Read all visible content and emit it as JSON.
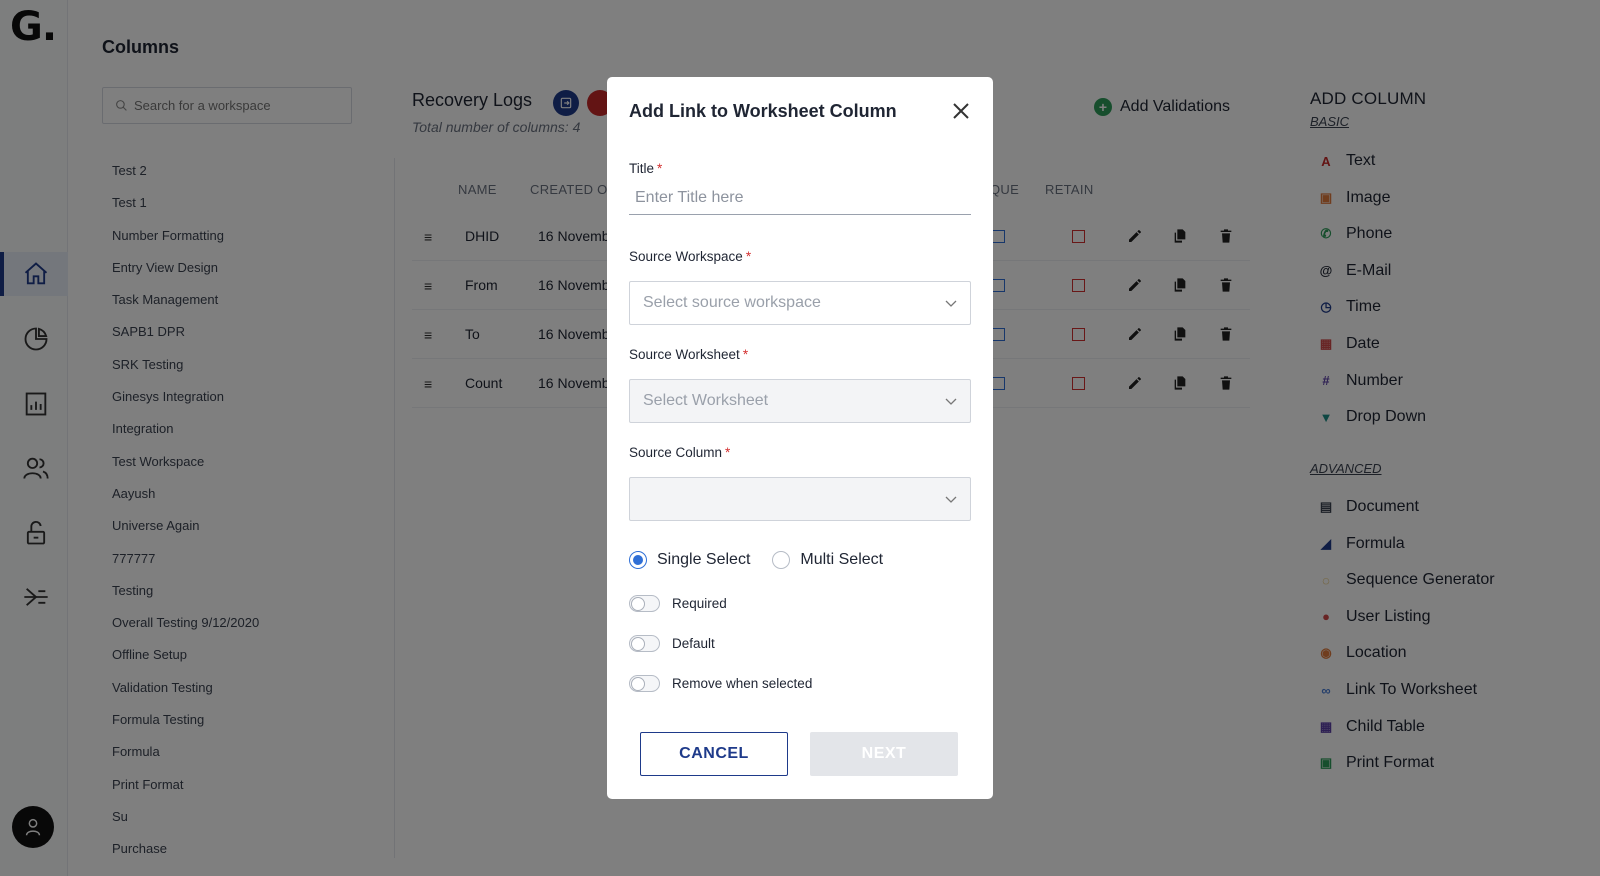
{
  "app": {
    "logo": "G."
  },
  "page": {
    "title": "Columns",
    "search_placeholder": "Search for a workspace"
  },
  "workspaces": [
    "Test 2",
    "Test 1",
    "Number Formatting",
    "Entry View Design",
    "Task Management",
    "SAPB1 DPR",
    "SRK Testing",
    "Ginesys Integration",
    "Integration",
    "Test Workspace",
    "Aayush",
    "Universe Again",
    "777777",
    "Testing",
    "Overall Testing 9/12/2020",
    "Offline Setup",
    "Validation Testing",
    "Formula Testing",
    "Formula",
    "Print Format",
    "Su",
    "Purchase"
  ],
  "table": {
    "title": "Recovery Logs",
    "subtitle": "Total number of columns: 4",
    "headers": {
      "name": "NAME",
      "created": "CREATED O",
      "unique": "QUE",
      "retain": "RETAIN"
    },
    "rows": [
      {
        "name": "DHID",
        "created": "16 Novemb"
      },
      {
        "name": "From",
        "created": "16 Novemb"
      },
      {
        "name": "To",
        "created": "16 Novemb"
      },
      {
        "name": "Count",
        "created": "16 Novemb"
      }
    ],
    "add_validations": "Add Validations"
  },
  "add_column": {
    "title": "ADD COLUMN",
    "basic_label": "BASIC",
    "advanced_label": "ADVANCED",
    "basic": [
      {
        "label": "Text",
        "icon": "text-icon",
        "color": "#c62828"
      },
      {
        "label": "Image",
        "icon": "image-icon",
        "color": "#e07a3c"
      },
      {
        "label": "Phone",
        "icon": "phone-icon",
        "color": "#2e9d5a"
      },
      {
        "label": "E-Mail",
        "icon": "email-icon",
        "color": "#1f2533"
      },
      {
        "label": "Time",
        "icon": "clock-icon",
        "color": "#1e3a8a"
      },
      {
        "label": "Date",
        "icon": "calendar-icon",
        "color": "#d04848"
      },
      {
        "label": "Number",
        "icon": "hash-icon",
        "color": "#5b3fa6"
      },
      {
        "label": "Drop Down",
        "icon": "dropdown-icon",
        "color": "#1c8f86"
      }
    ],
    "advanced": [
      {
        "label": "Document",
        "icon": "document-icon",
        "color": "#3b4250"
      },
      {
        "label": "Formula",
        "icon": "formula-icon",
        "color": "#1e3a8a"
      },
      {
        "label": "Sequence Generator",
        "icon": "sequence-icon",
        "color": "#d9a521"
      },
      {
        "label": "User Listing",
        "icon": "users-icon",
        "color": "#d04848"
      },
      {
        "label": "Location",
        "icon": "location-icon",
        "color": "#e07a3c"
      },
      {
        "label": "Link To Worksheet",
        "icon": "link-icon",
        "color": "#4a7fd6"
      },
      {
        "label": "Child Table",
        "icon": "table-icon",
        "color": "#5b3fa6"
      },
      {
        "label": "Print Format",
        "icon": "print-icon",
        "color": "#2e9d5a"
      }
    ]
  },
  "modal": {
    "title": "Add Link to Worksheet Column",
    "title_label": "Title",
    "title_placeholder": "Enter Title here",
    "source_workspace_label": "Source Workspace",
    "source_workspace_placeholder": "Select source workspace",
    "source_worksheet_label": "Source Worksheet",
    "source_worksheet_placeholder": "Select Worksheet",
    "source_column_label": "Source Column",
    "source_column_placeholder": "",
    "required_mark": "*",
    "single_select": "Single Select",
    "multi_select": "Multi Select",
    "toggle_required": "Required",
    "toggle_default": "Default",
    "toggle_remove": "Remove when selected",
    "cancel": "CANCEL",
    "next": "NEXT"
  }
}
